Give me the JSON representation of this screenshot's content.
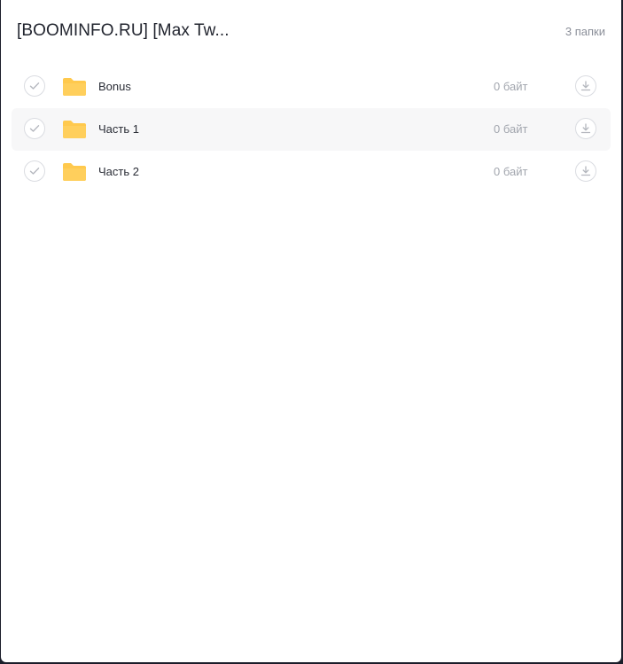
{
  "header": {
    "title": "[BOOMINFO.RU] [Max Tw...",
    "count": "3 папки"
  },
  "colors": {
    "folder": "#ffc94d",
    "folder_tab": "#f7b731",
    "row_highlight": "#f7f7f8"
  },
  "items": [
    {
      "name": "Bonus",
      "size": "0 байт",
      "icon": "folder-icon"
    },
    {
      "name": "Часть 1",
      "size": "0 байт",
      "icon": "folder-icon"
    },
    {
      "name": "Часть 2",
      "size": "0 байт",
      "icon": "folder-icon"
    }
  ]
}
